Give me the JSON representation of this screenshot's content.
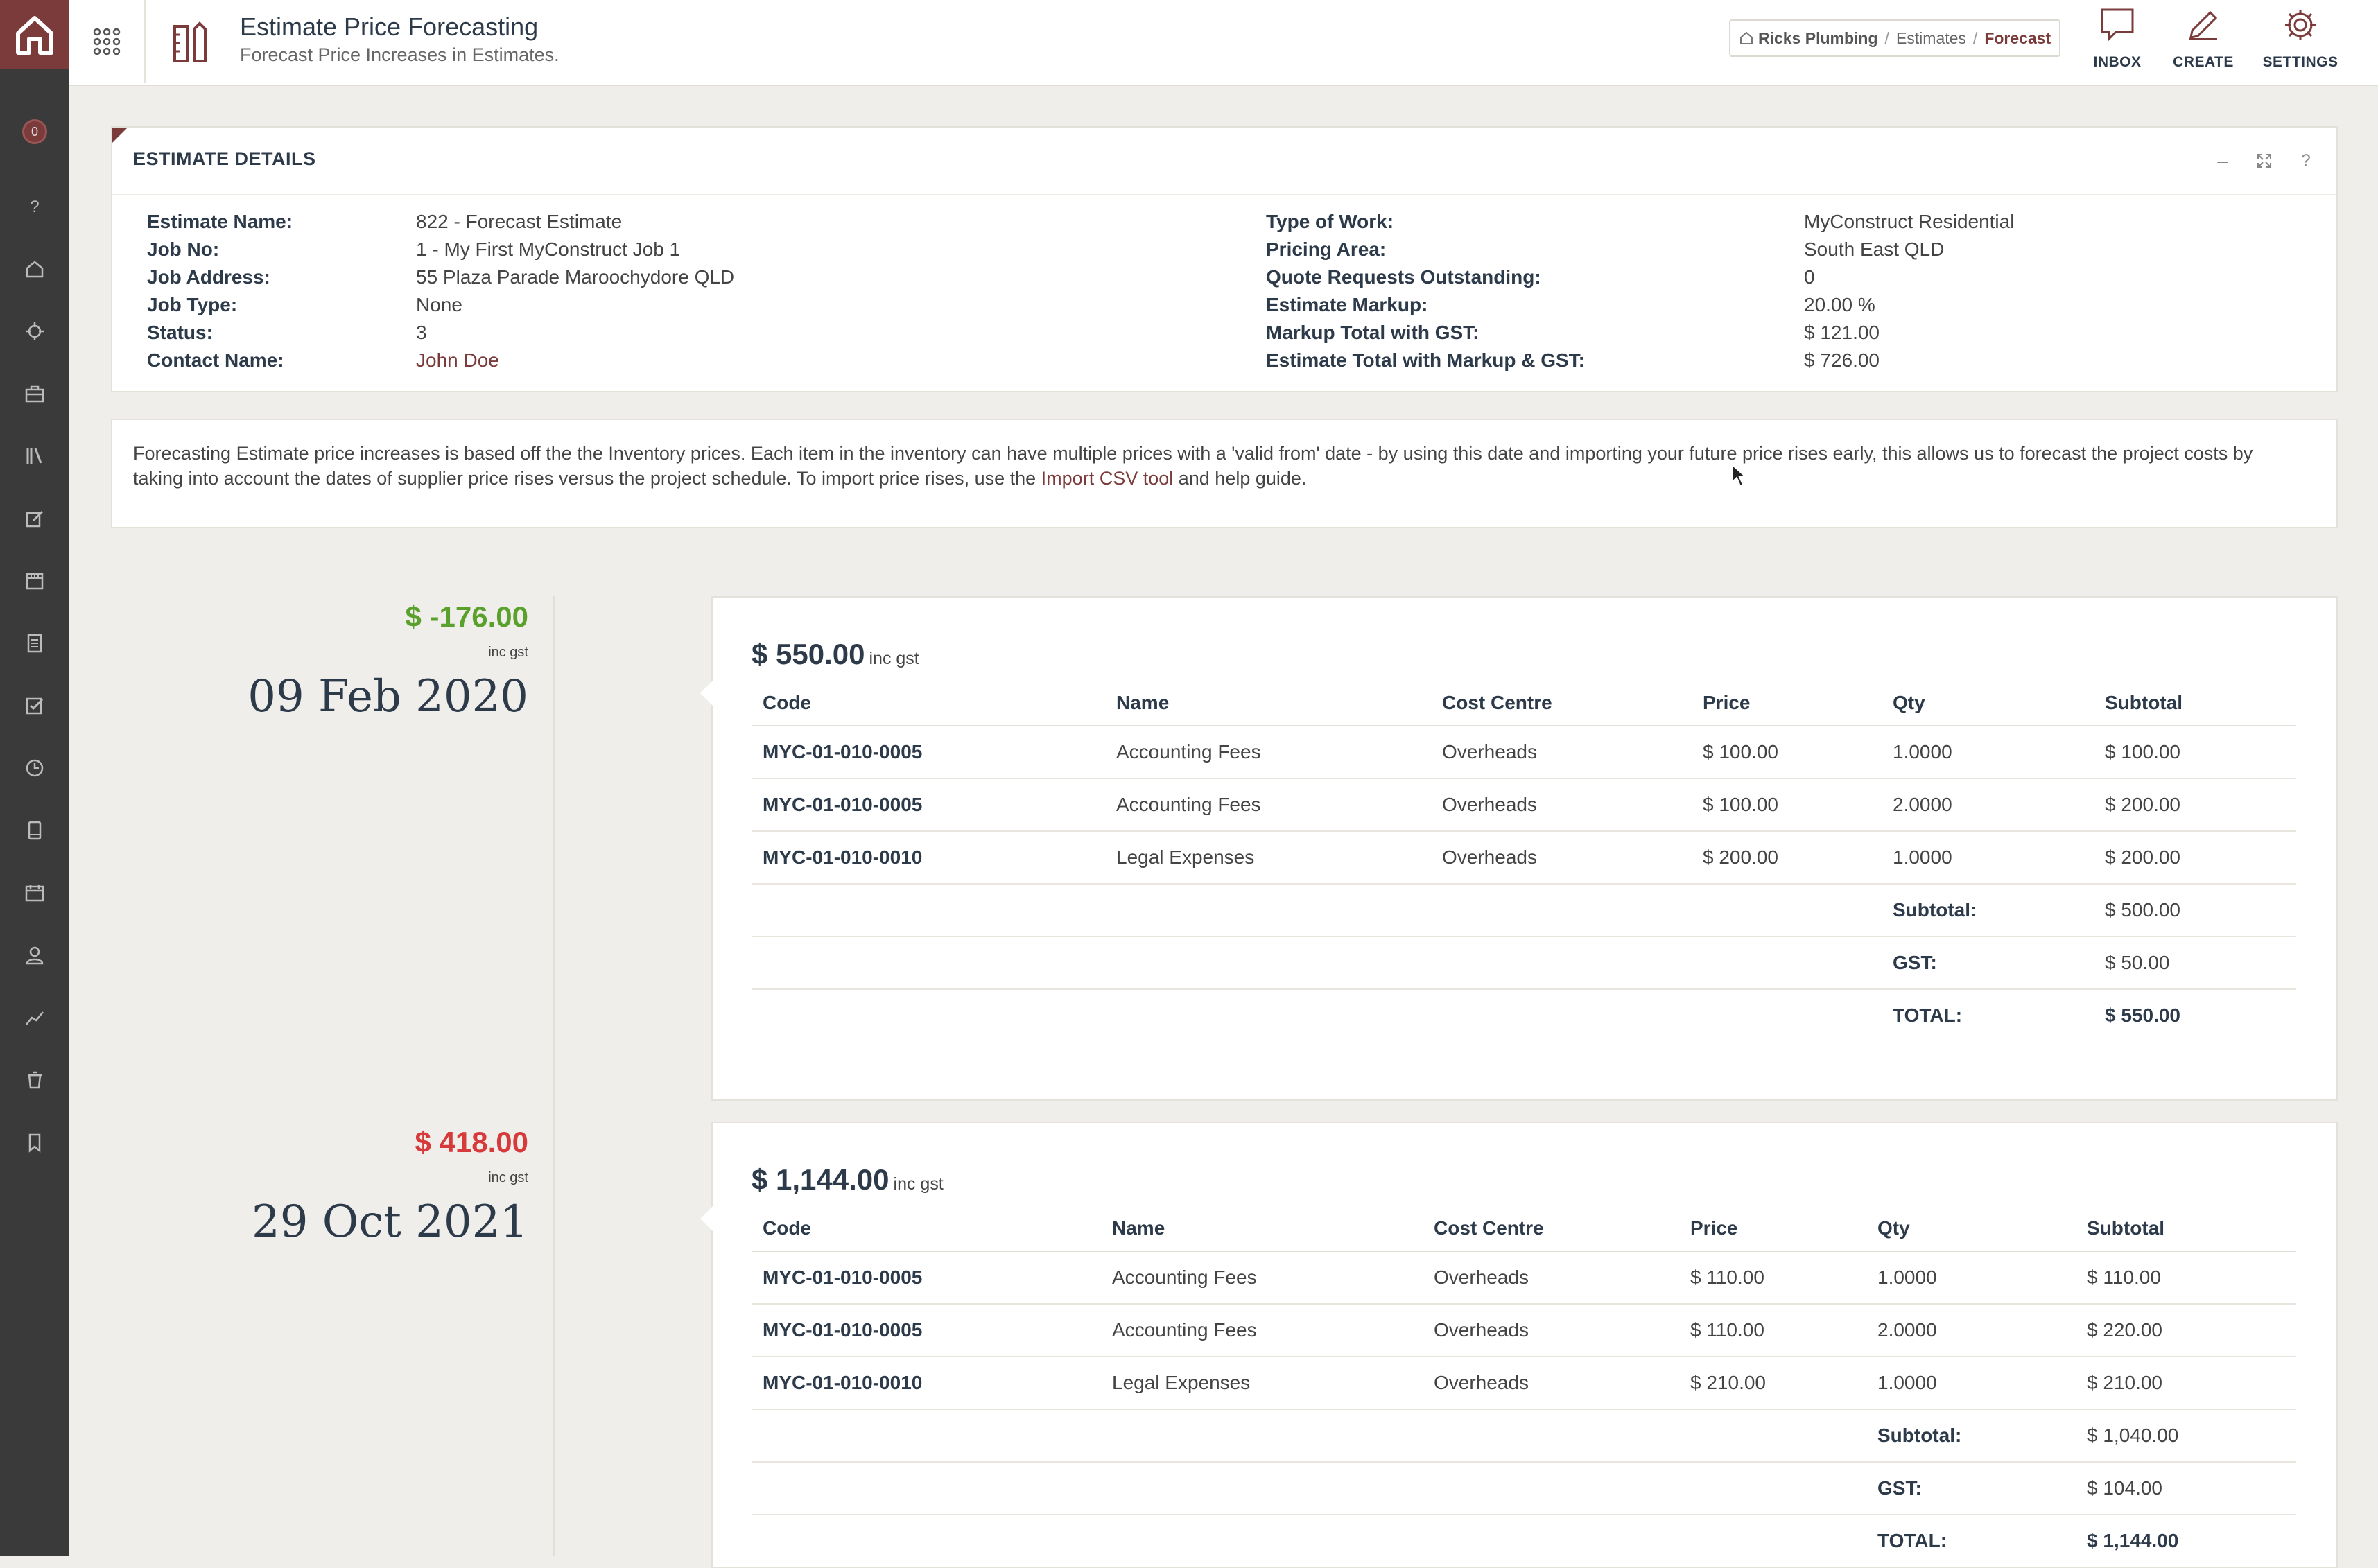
{
  "header": {
    "title": "Estimate Price Forecasting",
    "subtitle": "Forecast Price Increases in Estimates.",
    "breadcrumb": [
      "Ricks Plumbing",
      "Estimates",
      "Forecast"
    ],
    "buttons": {
      "inbox": "INBOX",
      "create": "CREATE",
      "settings": "SETTINGS"
    }
  },
  "sidebar": {
    "badge": "0",
    "items": [
      "help-icon",
      "home-icon",
      "crosshair-icon",
      "briefcase-icon",
      "book-icon",
      "edit-icon",
      "storefront-icon",
      "document-icon",
      "checklist-icon",
      "clock-icon",
      "device-icon",
      "calendar-icon",
      "person-icon",
      "chart-icon",
      "trash-icon",
      "bookmark-icon"
    ]
  },
  "details": {
    "title": "ESTIMATE DETAILS",
    "left": [
      {
        "label": "Estimate Name:",
        "value": "822 - Forecast Estimate"
      },
      {
        "label": "Job No:",
        "value": "1 - My First MyConstruct Job 1"
      },
      {
        "label": "Job Address:",
        "value": "55 Plaza Parade Maroochydore QLD"
      },
      {
        "label": "Job Type:",
        "value": "None"
      },
      {
        "label": "Status:",
        "value": "3"
      },
      {
        "label": "Contact Name:",
        "value": "John Doe"
      }
    ],
    "right": [
      {
        "label": "Type of Work:",
        "value": "MyConstruct Residential"
      },
      {
        "label": "Pricing Area:",
        "value": "South East QLD"
      },
      {
        "label": "Quote Requests Outstanding:",
        "value": "0"
      },
      {
        "label": "Estimate Markup:",
        "value": "20.00 %"
      },
      {
        "label": "Markup Total with GST:",
        "value": "$ 121.00"
      },
      {
        "label": "Estimate Total with Markup & GST:",
        "value": "$ 726.00"
      }
    ]
  },
  "info": {
    "text_before": "Forecasting Estimate price increases is based off the the Inventory prices. Each item in the inventory can have multiple prices with a 'valid from' date - by using this date and importing your future price rises early, this allows us to forecast the project costs by taking into account the dates of supplier price rises versus the project schedule. To import price rises, use the ",
    "link": "Import CSV tool",
    "text_after": " and help guide."
  },
  "columns": [
    "Code",
    "Name",
    "Cost Centre",
    "Price",
    "Qty",
    "Subtotal"
  ],
  "forecasts": [
    {
      "delta": "$ -176.00",
      "delta_sub": "inc gst",
      "date": "09 Feb 2020",
      "total": "$ 550.00",
      "total_sub": "inc gst",
      "rows": [
        [
          "MYC-01-010-0005",
          "Accounting Fees",
          "Overheads",
          "$ 100.00",
          "1.0000",
          "$ 100.00"
        ],
        [
          "MYC-01-010-0005",
          "Accounting Fees",
          "Overheads",
          "$ 100.00",
          "2.0000",
          "$ 200.00"
        ],
        [
          "MYC-01-010-0010",
          "Legal Expenses",
          "Overheads",
          "$ 200.00",
          "1.0000",
          "$ 200.00"
        ]
      ],
      "subtotal_label": "Subtotal:",
      "subtotal": "$ 500.00",
      "gst_label": "GST:",
      "gst": "$ 50.00",
      "total_label": "TOTAL:",
      "grand_total": "$ 550.00"
    },
    {
      "delta": "$ 418.00",
      "delta_sub": "inc gst",
      "date": "29 Oct 2021",
      "total": "$ 1,144.00",
      "total_sub": "inc gst",
      "rows": [
        [
          "MYC-01-010-0005",
          "Accounting Fees",
          "Overheads",
          "$ 110.00",
          "1.0000",
          "$ 110.00"
        ],
        [
          "MYC-01-010-0005",
          "Accounting Fees",
          "Overheads",
          "$ 110.00",
          "2.0000",
          "$ 220.00"
        ],
        [
          "MYC-01-010-0010",
          "Legal Expenses",
          "Overheads",
          "$ 210.00",
          "1.0000",
          "$ 210.00"
        ]
      ],
      "subtotal_label": "Subtotal:",
      "subtotal": "$ 1,040.00",
      "gst_label": "GST:",
      "gst": "$ 104.00",
      "total_label": "TOTAL:",
      "grand_total": "$ 1,144.00"
    }
  ]
}
